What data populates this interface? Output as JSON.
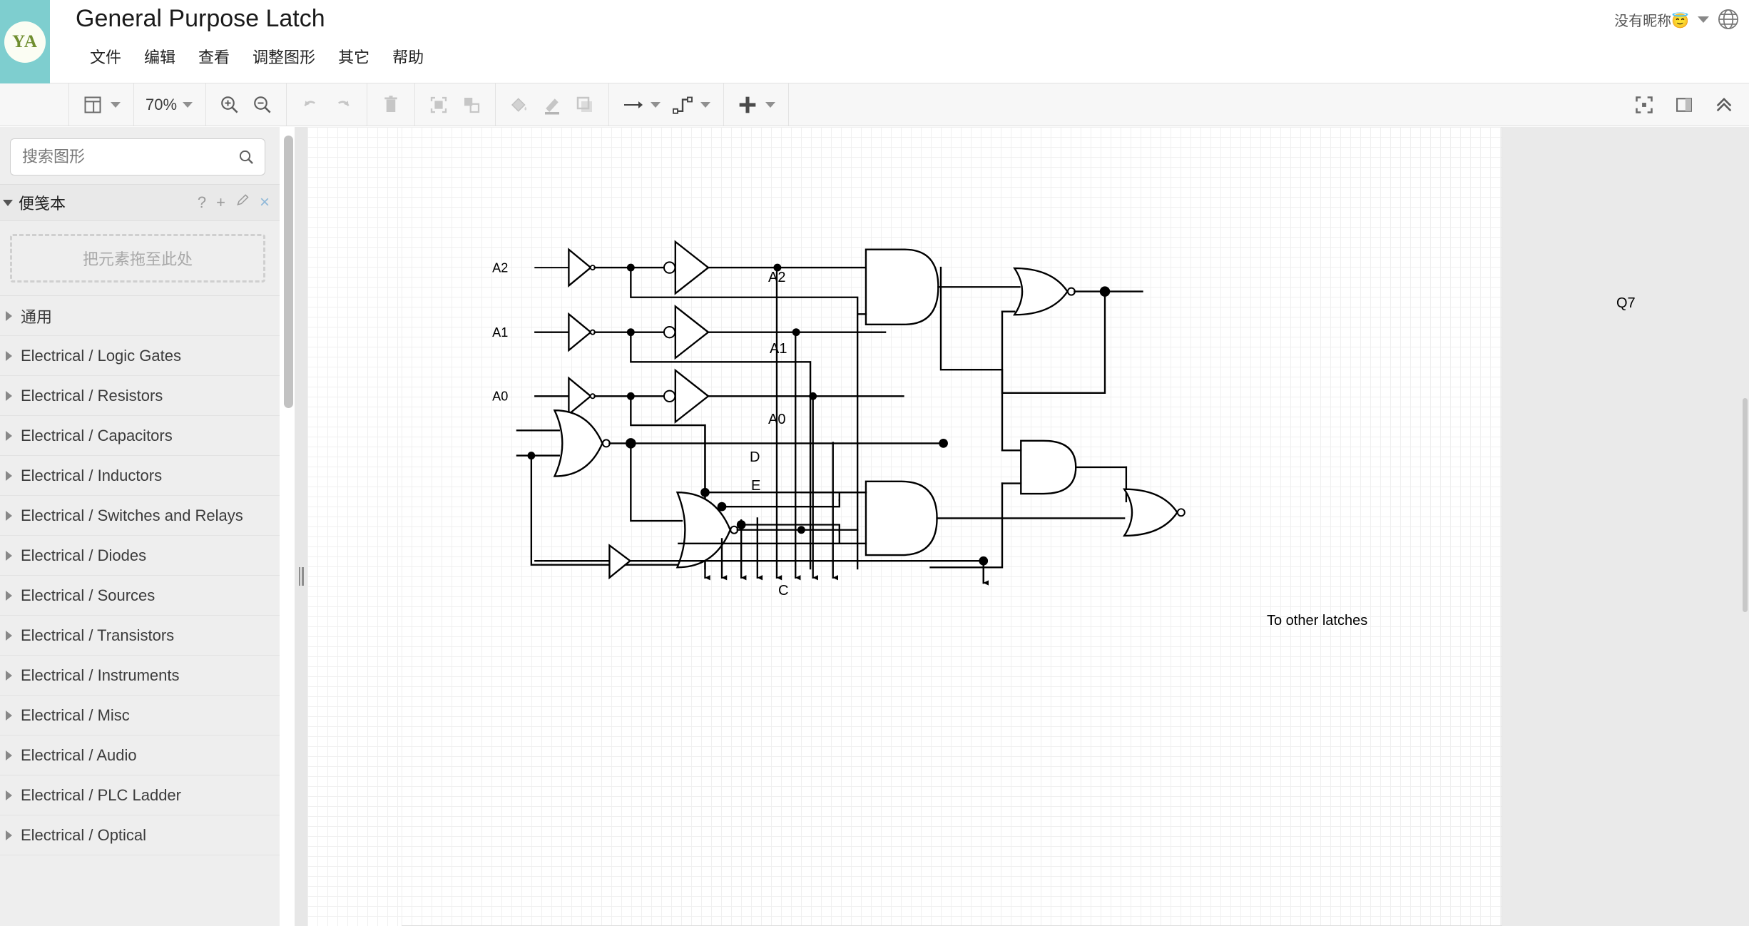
{
  "header": {
    "logo_text": "YA",
    "doc_title": "General Purpose Latch",
    "menu": [
      "文件",
      "编辑",
      "查看",
      "调整图形",
      "其它",
      "帮助"
    ],
    "user_name": "没有昵称😇",
    "user_caret_icon": "chevron-down-icon",
    "language_icon": "globe-icon"
  },
  "toolbar": {
    "layout_icon": "layout-panel-icon",
    "layout_caret": "chevron-down-icon",
    "zoom_value": "70%",
    "zoom_caret": "chevron-down-icon",
    "zoom_in_icon": "zoom-in-icon",
    "zoom_out_icon": "zoom-out-icon",
    "undo_icon": "undo-icon",
    "redo_icon": "redo-icon",
    "delete_icon": "trash-icon",
    "to_front_icon": "bring-to-front-icon",
    "to_back_icon": "send-to-back-icon",
    "fill_icon": "fill-color-icon",
    "line_icon": "line-color-icon",
    "shadow_icon": "shadow-icon",
    "connection_icon": "connection-arrow-icon",
    "waypoint_icon": "waypoint-icon",
    "insert_icon": "plus-icon",
    "fullscreen_icon": "fit-page-icon",
    "format_panel_icon": "format-panel-icon",
    "collapse_icon": "collapse-chevron-icon"
  },
  "sidebar": {
    "search_placeholder": "搜索图形",
    "search_value": "",
    "search_icon": "search-icon",
    "scratchpad": {
      "title": "便笺本",
      "collapse_icon": "triangle-down-icon",
      "help_icon": "?",
      "add_icon": "+",
      "edit_icon": "pencil-icon",
      "close_icon": "×",
      "dropzone_text": "把元素拖至此处"
    },
    "categories": [
      "通用",
      "Electrical / Logic Gates",
      "Electrical / Resistors",
      "Electrical / Capacitors",
      "Electrical / Inductors",
      "Electrical / Switches and Relays",
      "Electrical / Diodes",
      "Electrical / Sources",
      "Electrical / Transistors",
      "Electrical / Instruments",
      "Electrical / Misc",
      "Electrical / Audio",
      "Electrical / PLC Ladder",
      "Electrical / Optical"
    ]
  },
  "canvas": {
    "diagram_title": "General Purpose Latch",
    "labels": {
      "a2": "A2",
      "a1": "A1",
      "a0": "A0",
      "d": "D",
      "e": "E",
      "c": "C",
      "q7": "Q7",
      "to_other_latches": "To other latches"
    },
    "colors": {
      "wire": "#000000",
      "grid_minor": "#f0f0f0",
      "grid_major": "#e2e2e2",
      "paper": "#ffffff",
      "canvas_bg": "#eaeaea",
      "brand": "#7ececf"
    },
    "arrow_count": 8
  }
}
